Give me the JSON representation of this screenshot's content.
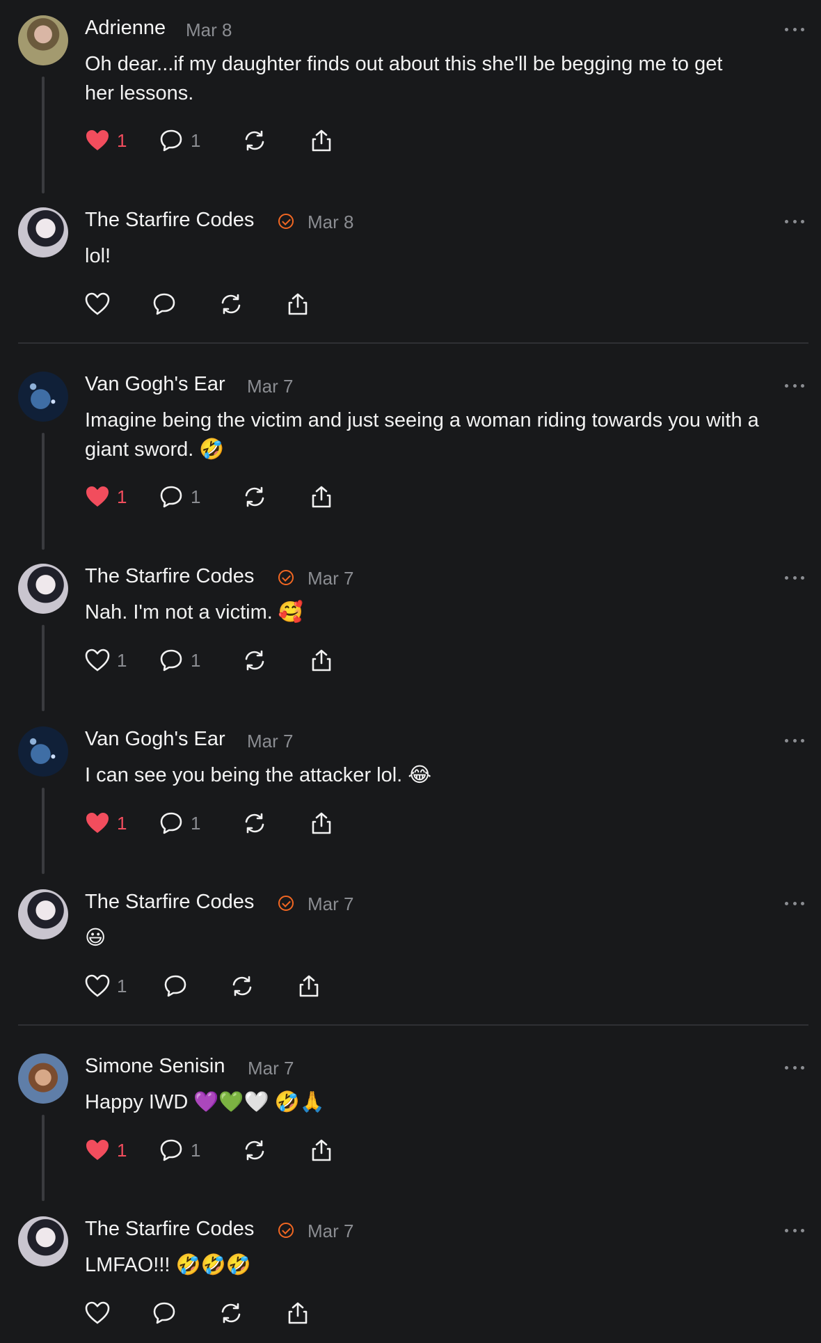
{
  "comments": [
    {
      "name": "Adrienne",
      "date": "Mar 8",
      "text": "Oh dear...if my daughter finds out about this she'll be begging me to get\nher lessons.",
      "likes": "1",
      "replies": "1",
      "liked": true
    },
    {
      "name": "The Starfire Codes",
      "date": "Mar 8",
      "text": "lol!",
      "likes": "",
      "replies": "",
      "liked": false
    },
    {
      "name": "Van Gogh's Ear",
      "date": "Mar 7",
      "text": "Imagine being the victim and just seeing a woman riding towards you with a\ngiant sword. 🤣",
      "likes": "1",
      "replies": "1",
      "liked": true
    },
    {
      "name": "The Starfire Codes",
      "date": "Mar 7",
      "text": "Nah. I'm not a victim. 🥰",
      "likes": "1",
      "replies": "1",
      "liked": false
    },
    {
      "name": "Van Gogh's Ear",
      "date": "Mar 7",
      "text": "I can see you being the attacker lol. 😂",
      "likes": "1",
      "replies": "1",
      "liked": true
    },
    {
      "name": "The Starfire Codes",
      "date": "Mar 7",
      "text": "😃",
      "likes": "1",
      "replies": "",
      "liked": false
    },
    {
      "name": "Simone Senisin",
      "date": "Mar 7",
      "text": "Happy IWD 💜💚🤍 🤣🙏",
      "likes": "1",
      "replies": "1",
      "liked": true
    },
    {
      "name": "The Starfire Codes",
      "date": "Mar 7",
      "text": "LMFAO!!! 🤣🤣🤣",
      "likes": "",
      "replies": "",
      "liked": false
    }
  ],
  "colors": {
    "background": "#18191b",
    "like": "#f24d5d",
    "verified": "#f26722",
    "muted": "#8b8d92"
  }
}
